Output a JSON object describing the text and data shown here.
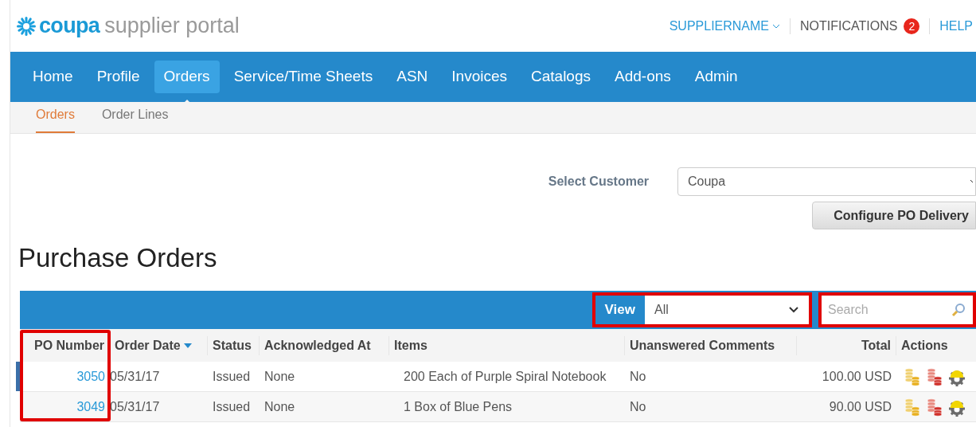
{
  "logo": {
    "brand": "coupa",
    "product": "supplier portal"
  },
  "top_links": {
    "user": "SUPPLIERNAME",
    "notifications": "NOTIFICATIONS",
    "notification_count": "2",
    "help": "HELP"
  },
  "nav": [
    {
      "label": "Home",
      "selected": false
    },
    {
      "label": "Profile",
      "selected": false
    },
    {
      "label": "Orders",
      "selected": true
    },
    {
      "label": "Service/Time Sheets",
      "selected": false
    },
    {
      "label": "ASN",
      "selected": false
    },
    {
      "label": "Invoices",
      "selected": false
    },
    {
      "label": "Catalogs",
      "selected": false
    },
    {
      "label": "Add-ons",
      "selected": false
    },
    {
      "label": "Admin",
      "selected": false
    }
  ],
  "subnav": [
    {
      "label": "Orders",
      "selected": true
    },
    {
      "label": "Order Lines",
      "selected": false
    }
  ],
  "customer": {
    "label": "Select Customer",
    "value": "Coupa"
  },
  "configure_button": "Configure PO Delivery",
  "page_title": "Purchase Orders",
  "toolbar": {
    "view_label": "View",
    "view_value": "All",
    "search_placeholder": "Search"
  },
  "table": {
    "columns": [
      "PO Number",
      "Order Date",
      "Status",
      "Acknowledged At",
      "Items",
      "Unanswered Comments",
      "Total",
      "Actions"
    ],
    "rows": [
      {
        "selected": true,
        "cells": [
          "3050",
          "05/31/17",
          "Issued",
          "None",
          "200 Each of Purple Spiral Notebook",
          "No",
          "100.00 USD"
        ]
      },
      {
        "selected": false,
        "cells": [
          "3049",
          "05/31/17",
          "Issued",
          "None",
          "1 Box of Blue Pens",
          "No",
          "90.00 USD"
        ]
      }
    ]
  }
}
